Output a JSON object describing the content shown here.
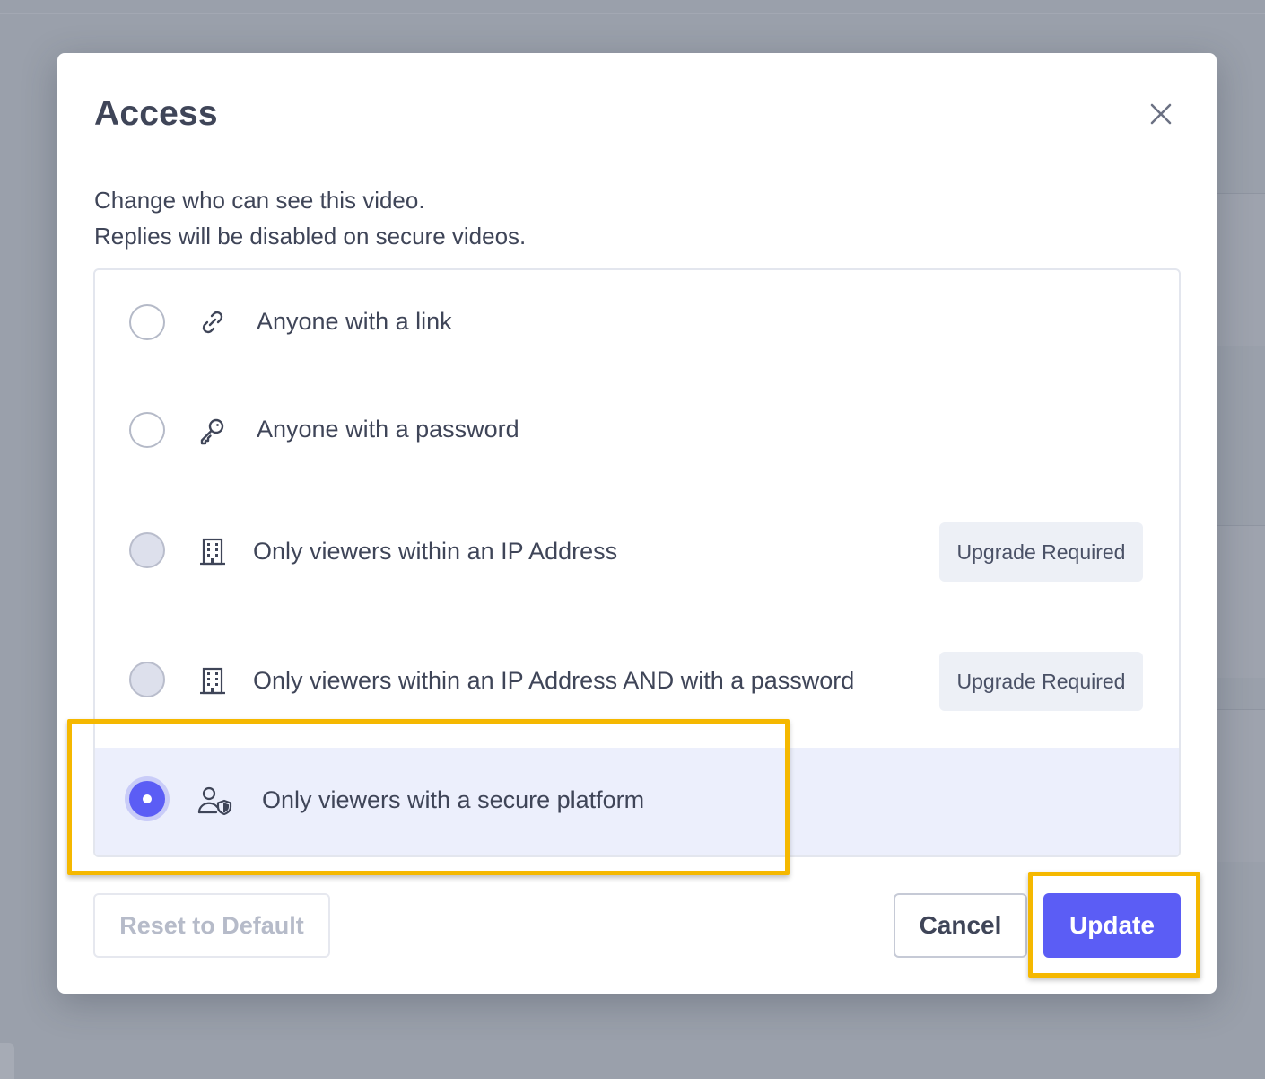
{
  "modal": {
    "title": "Access",
    "description_lines": [
      "Change who can see this video.",
      "Replies will be disabled on secure videos."
    ]
  },
  "options": [
    {
      "label": "Anyone with a link",
      "icon": "link-icon",
      "state": "unchecked",
      "badge": null
    },
    {
      "label": "Anyone with a password",
      "icon": "key-icon",
      "state": "unchecked",
      "badge": null
    },
    {
      "label": "Only viewers within an IP Address",
      "icon": "building-icon",
      "state": "disabled",
      "badge": "Upgrade Required"
    },
    {
      "label": "Only viewers within an IP Address AND with a password",
      "icon": "building-icon",
      "state": "disabled",
      "badge": "Upgrade Required"
    },
    {
      "label": "Only viewers with a secure platform",
      "icon": "user-shield-icon",
      "state": "checked",
      "badge": null
    }
  ],
  "footer": {
    "reset_label": "Reset to Default",
    "cancel_label": "Cancel",
    "update_label": "Update"
  },
  "colors": {
    "accent": "#5b5df5",
    "highlight": "#f5b800",
    "selected_row": "#eceffc"
  }
}
